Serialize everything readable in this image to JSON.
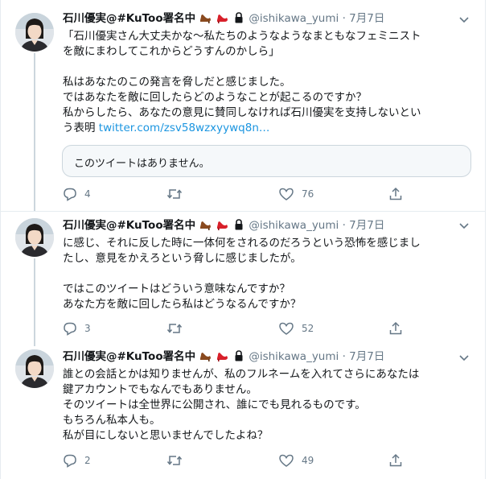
{
  "tweets": [
    {
      "name": "石川優実@#KuToo署名中",
      "handle": "@ishikawa_yumi",
      "separator": "·",
      "time": "7月7日",
      "text": "「石川優実さん大丈夫かな〜私たちのようなようなまともなフェミニスト\nを敵にまわしてこれからどうすんのかしら」\n\n私はあなたのこの発言を脅しだと感じました。\nではあなたを敵に回したらどのようなことが起こるのですか？\n私からしたら、あなたの意見に賛同しなければ石川優実を支持しないとい\nう表明 ",
      "link": "twitter.com/zsv58wzxyywq8n…",
      "quote_unavailable": "このツイートはありません。",
      "reply_count": "4",
      "retweet_count": "",
      "like_count": "76"
    },
    {
      "name": "石川優実@#KuToo署名中",
      "handle": "@ishikawa_yumi",
      "separator": "·",
      "time": "7月7日",
      "text": "に感じ、それに反した時に一体何をされるのだろうという恐怖を感じまし\nたし、意見をかえろという脅しに感じましたが。\n\nではこのツイートはどういう意味なんですか？\nあなた方を敵に回したら私はどうなるんですか？",
      "reply_count": "3",
      "retweet_count": "",
      "like_count": "52"
    },
    {
      "name": "石川優実@#KuToo署名中",
      "handle": "@ishikawa_yumi",
      "separator": "·",
      "time": "7月7日",
      "text": "誰との会話とかは知りませんが、私のフルネームを入れてさらにあなたは\n鍵アカウントでもなんでもありません。\nそのツイートは全世界に公開され、誰にでも見れるものです。\nもちろん私本人も。\n私が目にしないと思いませんでしたよね？",
      "reply_count": "2",
      "retweet_count": "",
      "like_count": "49"
    }
  ],
  "icons": {
    "reply": "speech-bubble-icon",
    "retweet": "retweet-arrows-icon",
    "like": "heart-outline-icon",
    "share": "share-upload-icon",
    "menu": "chevron-down-icon",
    "badges": [
      "high-heel-brown-emoji",
      "high-heel-red-emoji",
      "lock-icon"
    ]
  },
  "colors": {
    "text": "#14171a",
    "secondary": "#657786",
    "link": "#1b95e0",
    "border": "#e6ecf0",
    "thread_line": "#ccd6dd",
    "quote_bg": "#f5f8fa"
  }
}
